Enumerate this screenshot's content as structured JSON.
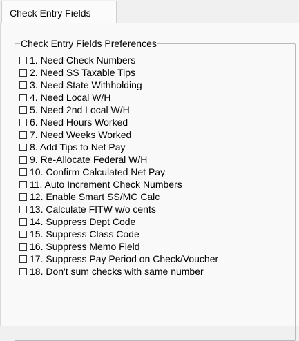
{
  "tabs": [
    {
      "label": "Check Entry Fields",
      "active": true
    }
  ],
  "group": {
    "title": "Check Entry Fields Preferences"
  },
  "items": [
    {
      "label": "1. Need Check Numbers",
      "checked": false
    },
    {
      "label": "2. Need SS Taxable Tips",
      "checked": false
    },
    {
      "label": "3. Need State Withholding",
      "checked": false
    },
    {
      "label": "4. Need Local W/H",
      "checked": false
    },
    {
      "label": "5. Need 2nd Local W/H",
      "checked": false
    },
    {
      "label": "6. Need Hours Worked",
      "checked": false
    },
    {
      "label": "7. Need Weeks Worked",
      "checked": false
    },
    {
      "label": "8. Add Tips to Net Pay",
      "checked": false
    },
    {
      "label": "9. Re-Allocate Federal W/H",
      "checked": false
    },
    {
      "label": "10. Confirm Calculated Net Pay",
      "checked": false
    },
    {
      "label": "11. Auto Increment Check Numbers",
      "checked": false
    },
    {
      "label": "12. Enable Smart SS/MC Calc",
      "checked": false
    },
    {
      "label": "13. Calculate FITW w/o cents",
      "checked": false
    },
    {
      "label": "14. Suppress Dept Code",
      "checked": false
    },
    {
      "label": "15. Suppress Class Code",
      "checked": false
    },
    {
      "label": "16. Suppress Memo Field",
      "checked": false
    },
    {
      "label": "17. Suppress Pay Period on Check/Voucher",
      "checked": false
    },
    {
      "label": "18. Don't sum checks with same number",
      "checked": false
    }
  ]
}
